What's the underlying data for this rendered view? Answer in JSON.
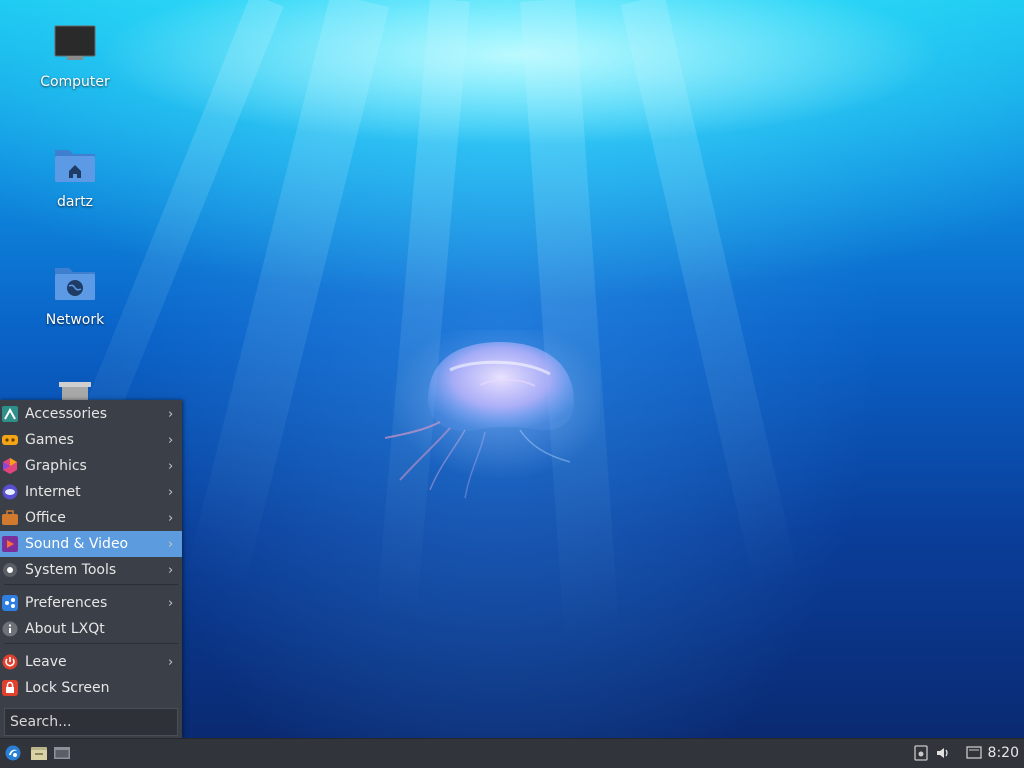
{
  "desktop": {
    "icons": [
      {
        "label": "Computer",
        "icon": "monitor-icon"
      },
      {
        "label": "dartz",
        "icon": "home-folder-icon"
      },
      {
        "label": "Network",
        "icon": "network-folder-icon"
      },
      {
        "label": "Trash",
        "icon": "trash-icon"
      }
    ]
  },
  "menu": {
    "items": [
      {
        "label": "Accessories",
        "icon": "accessories-icon",
        "has_submenu": true
      },
      {
        "label": "Games",
        "icon": "games-icon",
        "has_submenu": true
      },
      {
        "label": "Graphics",
        "icon": "graphics-icon",
        "has_submenu": true
      },
      {
        "label": "Internet",
        "icon": "internet-icon",
        "has_submenu": true
      },
      {
        "label": "Office",
        "icon": "office-icon",
        "has_submenu": true
      },
      {
        "label": "Sound & Video",
        "icon": "sound-video-icon",
        "has_submenu": true,
        "selected": true
      },
      {
        "label": "System Tools",
        "icon": "system-tools-icon",
        "has_submenu": true
      },
      {
        "label": "Preferences",
        "icon": "preferences-icon",
        "has_submenu": true
      },
      {
        "label": "About LXQt",
        "icon": "info-icon",
        "has_submenu": false
      },
      {
        "label": "Leave",
        "icon": "power-icon",
        "has_submenu": true
      },
      {
        "label": "Lock Screen",
        "icon": "lock-icon",
        "has_submenu": false
      }
    ],
    "search_placeholder": "Search..."
  },
  "taskbar": {
    "clock": "8:20",
    "left_icons": [
      "lxqt-logo-icon",
      "file-manager-icon",
      "show-desktop-icon"
    ],
    "tray_icons": [
      "removable-media-icon",
      "volume-icon",
      "network-tray-icon"
    ]
  },
  "colors": {
    "menu_bg": "#3b3f47",
    "menu_selected": "#5b9bde",
    "taskbar_bg": "#31343a"
  }
}
